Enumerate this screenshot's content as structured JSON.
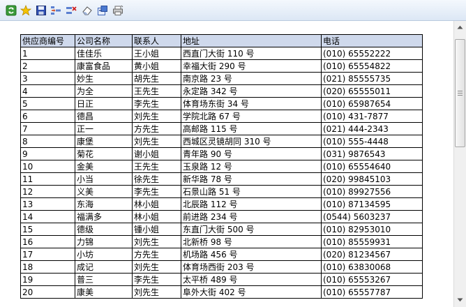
{
  "toolbar": {
    "buttons": [
      {
        "name": "refresh-button",
        "icon": "refresh-icon"
      },
      {
        "name": "favorite-button",
        "icon": "star-icon"
      },
      {
        "name": "save-button",
        "icon": "save-icon"
      },
      {
        "name": "insert-row-button",
        "icon": "insert-row-icon"
      },
      {
        "name": "delete-row-button",
        "icon": "delete-row-icon"
      },
      {
        "name": "clear-button",
        "icon": "eraser-icon"
      },
      {
        "name": "export-button",
        "icon": "export-icon"
      },
      {
        "name": "print-button",
        "icon": "printer-icon"
      }
    ]
  },
  "table": {
    "headers": [
      "供应商编号",
      "公司名称",
      "联系人",
      "地址",
      "电话"
    ],
    "rows": [
      [
        "1",
        "佳佳乐",
        "王小姐",
        "西直门大街 110 号",
        "(010) 65552222"
      ],
      [
        "2",
        "康富食品",
        "黄小姐",
        "幸福大街 290 号",
        "(010) 65554822"
      ],
      [
        "3",
        "妙生",
        "胡先生",
        "南京路 23 号",
        "(021) 85555735"
      ],
      [
        "4",
        "为全",
        "王先生",
        "永定路 342 号",
        "(020) 65555011"
      ],
      [
        "5",
        "日正",
        "李先生",
        "体育场东街 34 号",
        "(010) 65987654"
      ],
      [
        "6",
        "德昌",
        "刘先生",
        "学院北路 67 号",
        "(010) 431-7877"
      ],
      [
        "7",
        "正一",
        "方先生",
        "高邮路 115 号",
        "(021) 444-2343"
      ],
      [
        "8",
        "康堡",
        "刘先生",
        "西城区灵镜胡同 310 号",
        "(010) 555-4448"
      ],
      [
        "9",
        "菊花",
        "谢小姐",
        "青年路 90 号",
        "(031) 9876543"
      ],
      [
        "10",
        "金美",
        "王先生",
        "玉泉路 12 号",
        "(010) 65554640"
      ],
      [
        "11",
        "小当",
        "徐先生",
        "新华路 78 号",
        "(020) 99845103"
      ],
      [
        "12",
        "义美",
        "李先生",
        "石景山路 51 号",
        "(010) 89927556"
      ],
      [
        "13",
        "东海",
        "林小姐",
        "北辰路 112 号",
        "(010) 87134595"
      ],
      [
        "14",
        "福满多",
        "林小姐",
        "前进路 234 号",
        "(0544) 5603237"
      ],
      [
        "15",
        "德级",
        "锺小姐",
        "东直门大街 500 号",
        "(010) 82953010"
      ],
      [
        "16",
        "力锦",
        "刘先生",
        "北新桥 98 号",
        "(010) 85559931"
      ],
      [
        "17",
        "小坊",
        "方先生",
        "机场路 456 号",
        "(020) 81234567"
      ],
      [
        "18",
        "成记",
        "刘先生",
        "体育场西街 203 号",
        "(010) 63830068"
      ],
      [
        "19",
        "普三",
        "李先生",
        "太平桥 489 号",
        "(010) 65553267"
      ],
      [
        "20",
        "康美",
        "刘先生",
        "阜外大街 402 号",
        "(010) 65557787"
      ]
    ]
  },
  "scrollbar": {
    "position_fraction": 0.0
  }
}
